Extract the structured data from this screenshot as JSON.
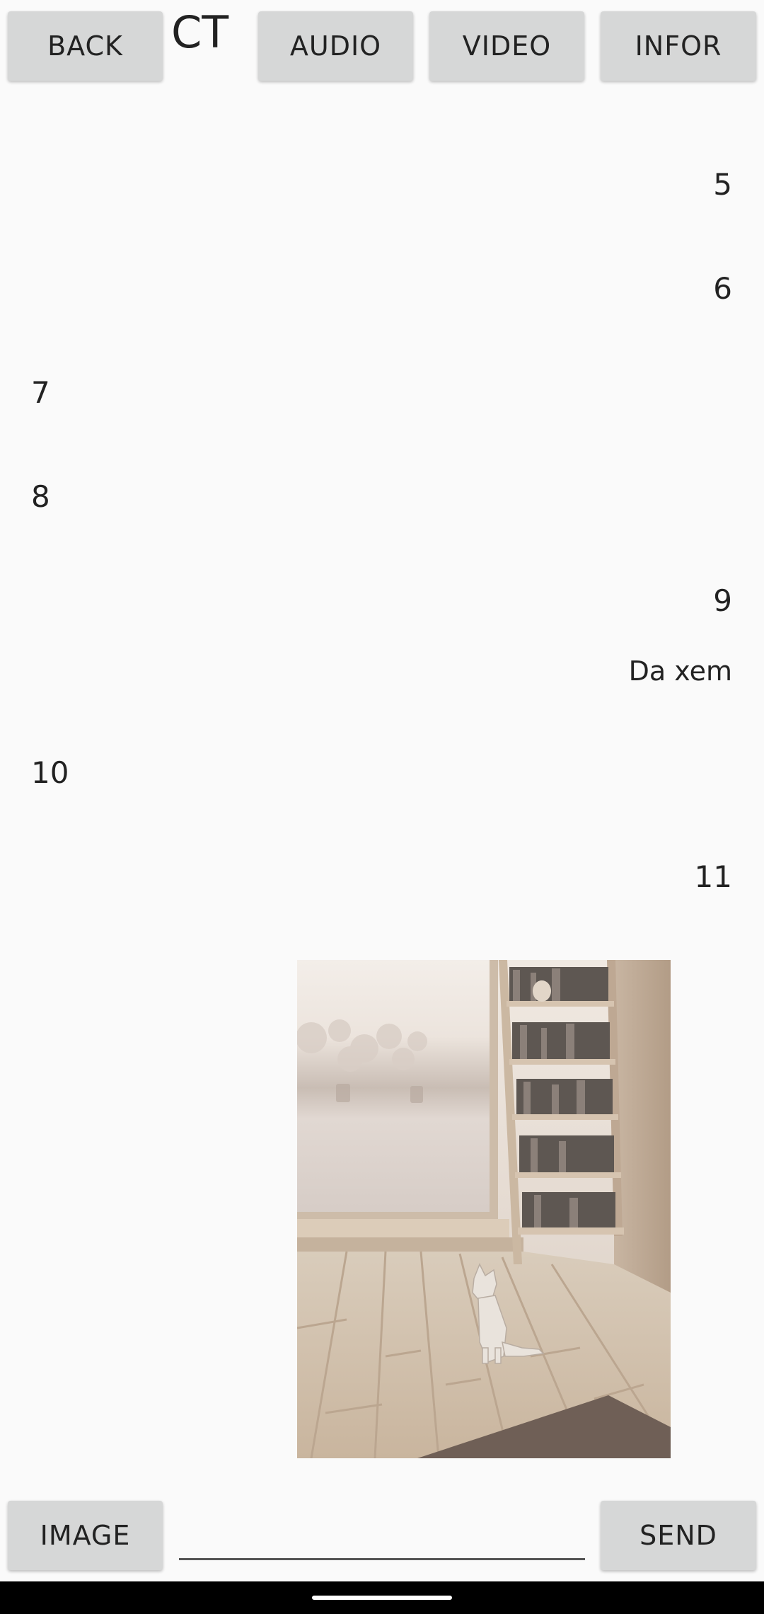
{
  "header": {
    "back_label": "BACK",
    "title": "CT",
    "audio_label": "AUDIO",
    "video_label": "VIDEO",
    "infor_label": "INFOR"
  },
  "messages": [
    {
      "text": "5",
      "side": "right"
    },
    {
      "text": "6",
      "side": "right"
    },
    {
      "text": "7",
      "side": "left"
    },
    {
      "text": "8",
      "side": "left"
    },
    {
      "text": "9",
      "side": "right"
    },
    {
      "text": "Da xem",
      "side": "right"
    },
    {
      "text": "10",
      "side": "left"
    },
    {
      "text": "11",
      "side": "right"
    }
  ],
  "image_message": {
    "description_icon": "photo-image",
    "side": "right"
  },
  "composer": {
    "image_label": "IMAGE",
    "input_value": "",
    "input_placeholder": "",
    "send_label": "SEND"
  },
  "colors": {
    "background": "#fafafa",
    "button": "#d6d7d7",
    "text": "#212121",
    "nav_bar": "#000000"
  }
}
